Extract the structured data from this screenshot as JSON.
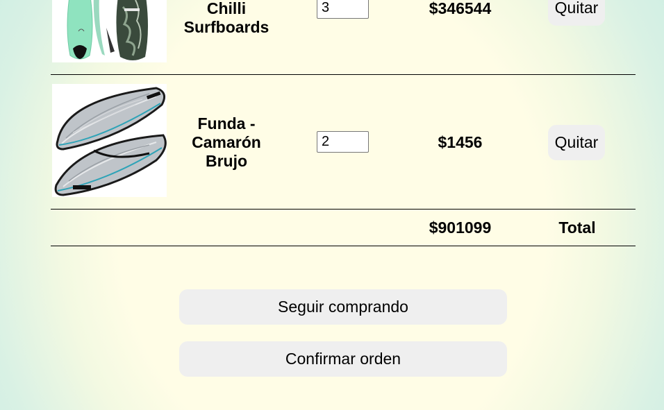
{
  "cart": {
    "items": [
      {
        "image_alt": "Tablas de surf Chilli",
        "name": "Chilli Surfboards",
        "quantity": "3",
        "price": "$346544",
        "remove_label": "Quitar"
      },
      {
        "image_alt": "Funda para tabla de surf",
        "name": "Funda - Camarón Brujo",
        "quantity": "2",
        "price": "$1456",
        "remove_label": "Quitar"
      }
    ],
    "total_value": "$901099",
    "total_label": "Total"
  },
  "actions": {
    "continue_shopping": "Seguir comprando",
    "confirm_order": "Confirmar orden"
  },
  "colors": {
    "button_bg": "#efefef",
    "page_center": "#fffde6",
    "page_edge": "#cdeee3"
  }
}
